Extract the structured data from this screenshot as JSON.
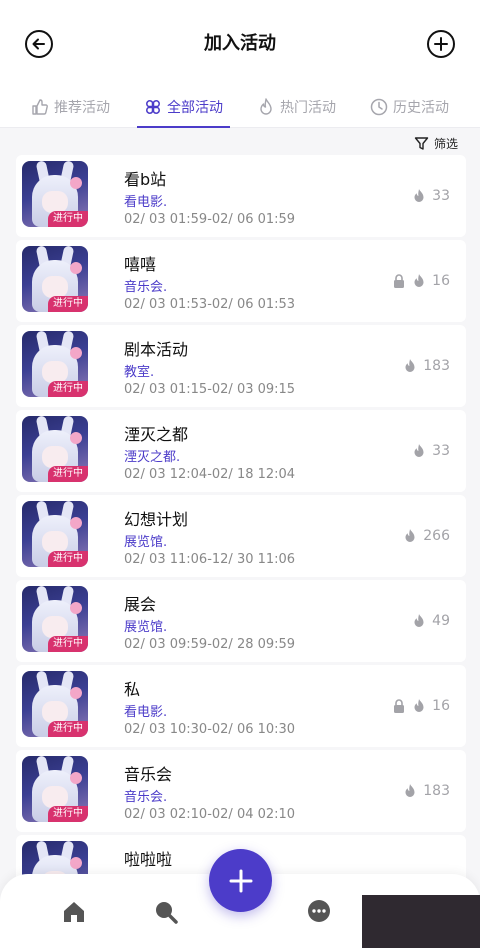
{
  "header": {
    "title": "加入活动",
    "back_icon": "arrow-left-circle-icon",
    "add_icon": "plus-circle-icon"
  },
  "tabs": [
    {
      "label": "推荐活动",
      "icon": "thumbs-up-icon",
      "active": false
    },
    {
      "label": "全部活动",
      "icon": "clover-icon",
      "active": true
    },
    {
      "label": "热门活动",
      "icon": "flame-icon",
      "active": false
    },
    {
      "label": "历史活动",
      "icon": "clock-icon",
      "active": false
    }
  ],
  "filter": {
    "label": "筛选",
    "icon": "funnel-icon"
  },
  "activities": [
    {
      "name": "看b站",
      "category": "看电影.",
      "time": "02/ 03 01:59-02/ 06 01:59",
      "status": "进行中",
      "count": "33",
      "locked": false
    },
    {
      "name": "嘻嘻",
      "category": "音乐会.",
      "time": "02/ 03 01:53-02/ 06 01:53",
      "status": "进行中",
      "count": "16",
      "locked": true
    },
    {
      "name": "剧本活动",
      "category": "教室.",
      "time": "02/ 03 01:15-02/ 03 09:15",
      "status": "进行中",
      "count": "183",
      "locked": false
    },
    {
      "name": "湮灭之都",
      "category": "湮灭之都.",
      "time": "02/ 03 12:04-02/ 18 12:04",
      "status": "进行中",
      "count": "33",
      "locked": false
    },
    {
      "name": "幻想计划",
      "category": "展览馆.",
      "time": "02/ 03 11:06-12/ 30 11:06",
      "status": "进行中",
      "count": "266",
      "locked": false
    },
    {
      "name": "展会",
      "category": "展览馆.",
      "time": "02/ 03 09:59-02/ 28 09:59",
      "status": "进行中",
      "count": "49",
      "locked": false
    },
    {
      "name": "私",
      "category": "看电影.",
      "time": "02/ 03 10:30-02/ 06 10:30",
      "status": "进行中",
      "count": "16",
      "locked": true
    },
    {
      "name": "音乐会",
      "category": "音乐会.",
      "time": "02/ 03 02:10-02/ 04 02:10",
      "status": "进行中",
      "count": "183",
      "locked": false
    },
    {
      "name": "啦啦啦",
      "category": "",
      "time": "",
      "status": "",
      "count": "",
      "locked": false
    }
  ],
  "bottom_nav": [
    {
      "icon": "home-icon"
    },
    {
      "icon": "search-icon"
    },
    {
      "icon": "chat-icon"
    }
  ],
  "colors": {
    "accent": "#4c3cc9",
    "badge": "#d8326e"
  }
}
